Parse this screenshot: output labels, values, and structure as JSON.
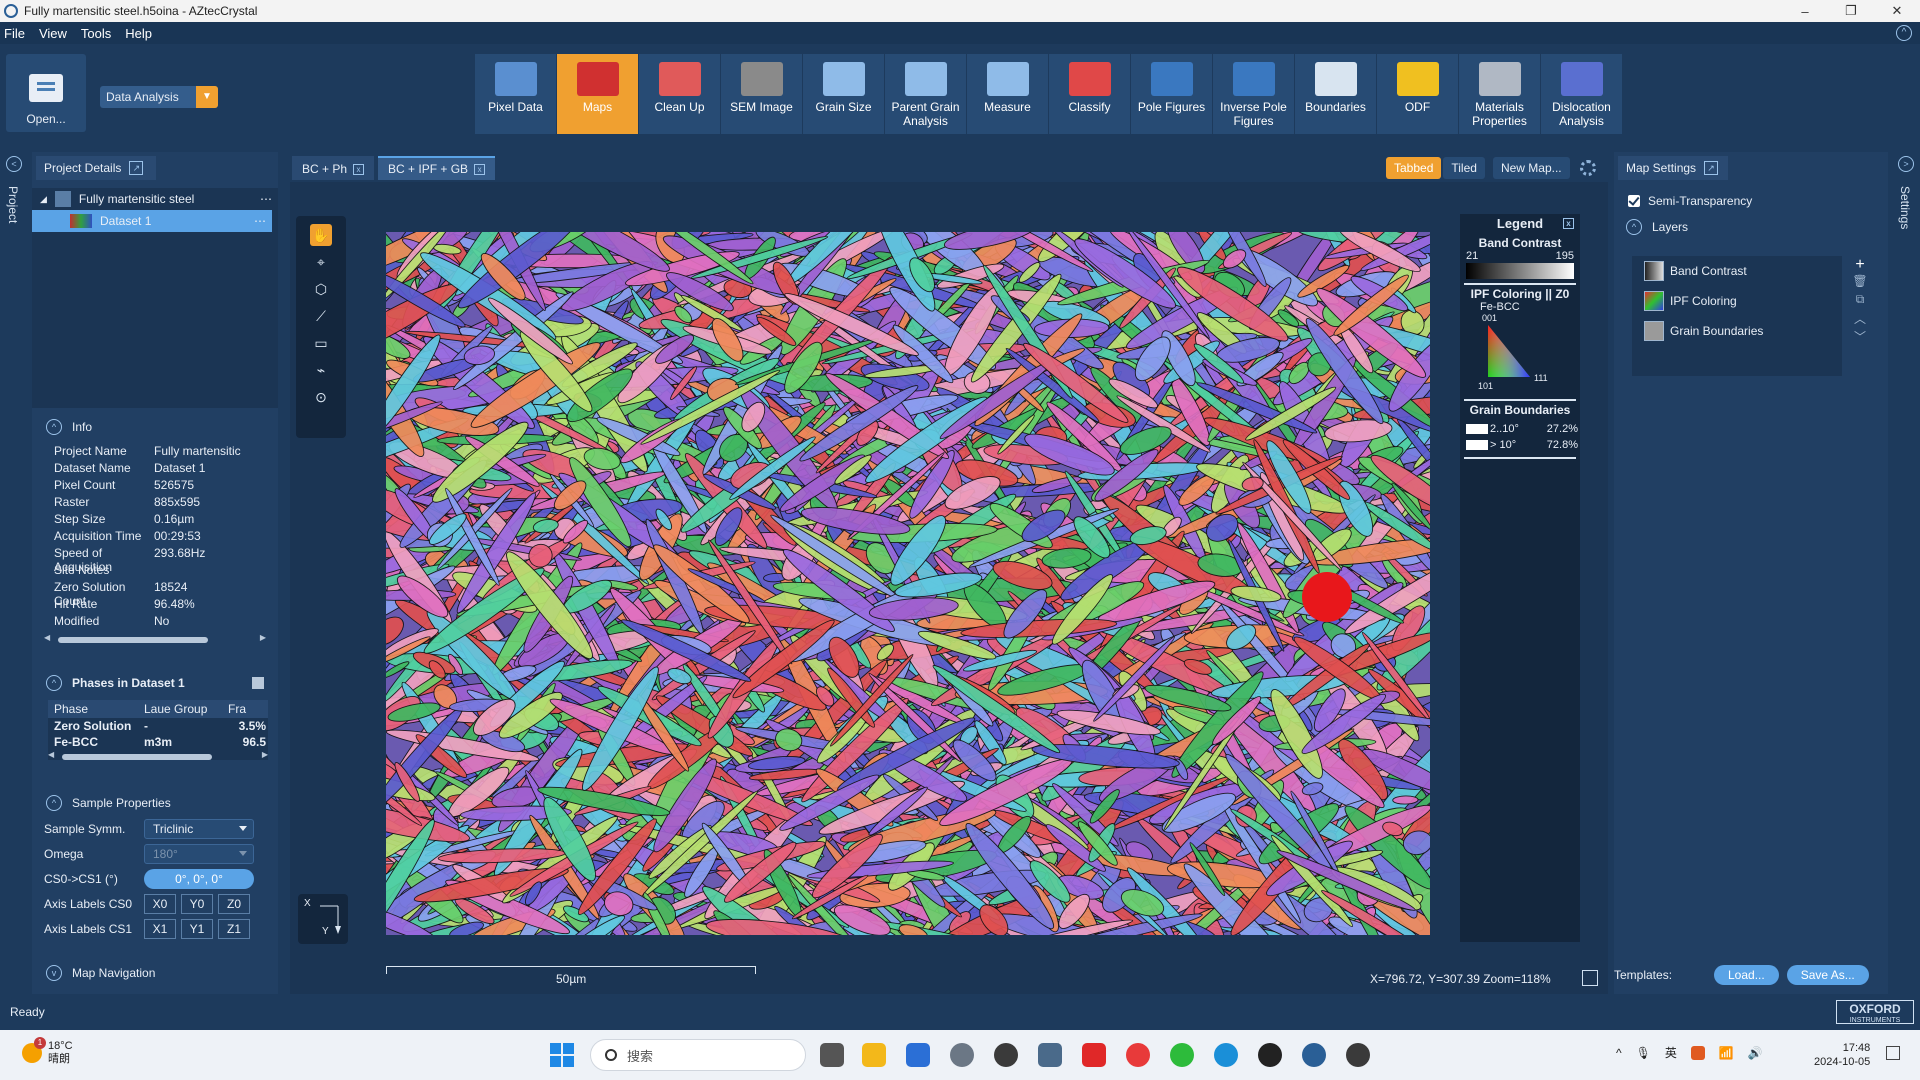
{
  "window": {
    "title": "Fully martensitic steel.h5oina - AZtecCrystal",
    "minimize": "–",
    "maximize": "❐",
    "close": "✕"
  },
  "menu": [
    "File",
    "View",
    "Tools",
    "Help"
  ],
  "ribbon": {
    "open_label": "Open...",
    "mode_label": "Data Analysis",
    "tools": [
      {
        "label": "Pixel Data",
        "icon": "pixel-data-icon",
        "color": "#5a8fd0",
        "active": false
      },
      {
        "label": "Maps",
        "icon": "maps-icon",
        "color": "#d03030",
        "active": true
      },
      {
        "label": "Clean Up",
        "icon": "clean-up-icon",
        "color": "#e05a5a",
        "active": false
      },
      {
        "label": "SEM Image",
        "icon": "sem-image-icon",
        "color": "#8a8a8a",
        "active": false
      },
      {
        "label": "Grain Size",
        "icon": "grain-size-icon",
        "color": "#8fbbe8",
        "active": false
      },
      {
        "label": "Parent Grain\nAnalysis",
        "icon": "parent-grain-icon",
        "color": "#8fbbe8",
        "active": false
      },
      {
        "label": "Measure",
        "icon": "measure-icon",
        "color": "#8fbbe8",
        "active": false
      },
      {
        "label": "Classify",
        "icon": "classify-icon",
        "color": "#e04848",
        "active": false
      },
      {
        "label": "Pole Figures",
        "icon": "pole-figures-icon",
        "color": "#3a78c0",
        "active": false
      },
      {
        "label": "Inverse Pole\nFigures",
        "icon": "inverse-pole-figures-icon",
        "color": "#3a78c0",
        "active": false
      },
      {
        "label": "Boundaries",
        "icon": "boundaries-icon",
        "color": "#d8e4f0",
        "active": false
      },
      {
        "label": "ODF",
        "icon": "odf-icon",
        "color": "#f0c020",
        "active": false
      },
      {
        "label": "Materials\nProperties",
        "icon": "materials-properties-icon",
        "color": "#b0b8c4",
        "active": false
      },
      {
        "label": "Dislocation\nAnalysis",
        "icon": "dislocation-analysis-icon",
        "color": "#5a6fd0",
        "active": false
      }
    ]
  },
  "left_strip": {
    "project_label": "Project"
  },
  "project": {
    "tab_label": "Project Details",
    "tree": {
      "project": "Fully martensitic steel",
      "dataset": "Dataset 1"
    },
    "info": {
      "title": "Info",
      "rows": [
        {
          "k": "Project Name",
          "v": "Fully martensitic"
        },
        {
          "k": "Dataset Name",
          "v": "Dataset 1"
        },
        {
          "k": "Pixel Count",
          "v": "526575"
        },
        {
          "k": "Raster",
          "v": "885x595"
        },
        {
          "k": "Step Size",
          "v": "0.16µm"
        },
        {
          "k": "Acquisition Time",
          "v": "00:29:53"
        },
        {
          "k": "Speed of Acquisition",
          "v": "293.68Hz"
        },
        {
          "k": "Site Notes",
          "v": ""
        },
        {
          "k": "Zero Solution Count",
          "v": "18524"
        },
        {
          "k": "Hit Rate",
          "v": "96.48%"
        },
        {
          "k": "Modified",
          "v": "No"
        }
      ]
    },
    "phases": {
      "title": "Phases in Dataset 1",
      "headers": [
        "Phase",
        "Laue Group",
        "Fra"
      ],
      "rows": [
        [
          "Zero Solution",
          "-",
          "3.5%"
        ],
        [
          "Fe-BCC",
          "m3m",
          "96.5"
        ]
      ]
    },
    "sample": {
      "title": "Sample Properties",
      "symm_label": "Sample Symm.",
      "symm_value": "Triclinic",
      "omega_label": "Omega",
      "omega_value": "180°",
      "cs_label": "CS0->CS1 (°)",
      "cs_value": "0°, 0°, 0°",
      "axis0_label": "Axis Labels CS0",
      "axis0": [
        "X0",
        "Y0",
        "Z0"
      ],
      "axis1_label": "Axis Labels CS1",
      "axis1": [
        "X1",
        "Y1",
        "Z1"
      ]
    },
    "map_nav": "Map Navigation"
  },
  "center": {
    "tabs": [
      "BC + Ph",
      "BC + IPF + GB"
    ],
    "view_buttons": {
      "tabbed": "Tabbed",
      "tiled": "Tiled",
      "new_map": "New Map..."
    },
    "axes_mini": {
      "x": "X",
      "y": "Y"
    },
    "scale_label": "50µm",
    "readout": "X=796.72, Y=307.39 Zoom=118%"
  },
  "legend": {
    "title": "Legend",
    "band_contrast": {
      "title": "Band Contrast",
      "min": "21",
      "max": "195"
    },
    "ipf": {
      "title": "IPF Coloring || Z0",
      "phase": "Fe-BCC",
      "top": "001",
      "left": "101",
      "right": "111"
    },
    "grain_boundaries": {
      "title": "Grain Boundaries",
      "rows": [
        {
          "label": "2..10°",
          "pct": "27.2%"
        },
        {
          "label": "> 10°",
          "pct": "72.8%"
        }
      ]
    }
  },
  "settings": {
    "tab_label": "Map Settings",
    "semi_transparency": "Semi-Transparency",
    "layers_title": "Layers",
    "layers": [
      {
        "name": "Band Contrast",
        "icon": "band-contrast-layer-icon"
      },
      {
        "name": "IPF Coloring",
        "icon": "ipf-coloring-layer-icon"
      },
      {
        "name": "Grain Boundaries",
        "icon": "grain-boundaries-layer-icon"
      }
    ],
    "templates_label": "Templates:",
    "load": "Load...",
    "save_as": "Save As...",
    "side_label": "Settings"
  },
  "status": {
    "text": "Ready",
    "logo_line1": "OXFORD",
    "logo_line2": "INSTRUMENTS"
  },
  "taskbar": {
    "temp": "18°C",
    "weather": "晴朗",
    "weather_badge": "1",
    "search": "搜索",
    "tray_ime": "英",
    "time": "17:48",
    "date": "2024-10-05"
  }
}
